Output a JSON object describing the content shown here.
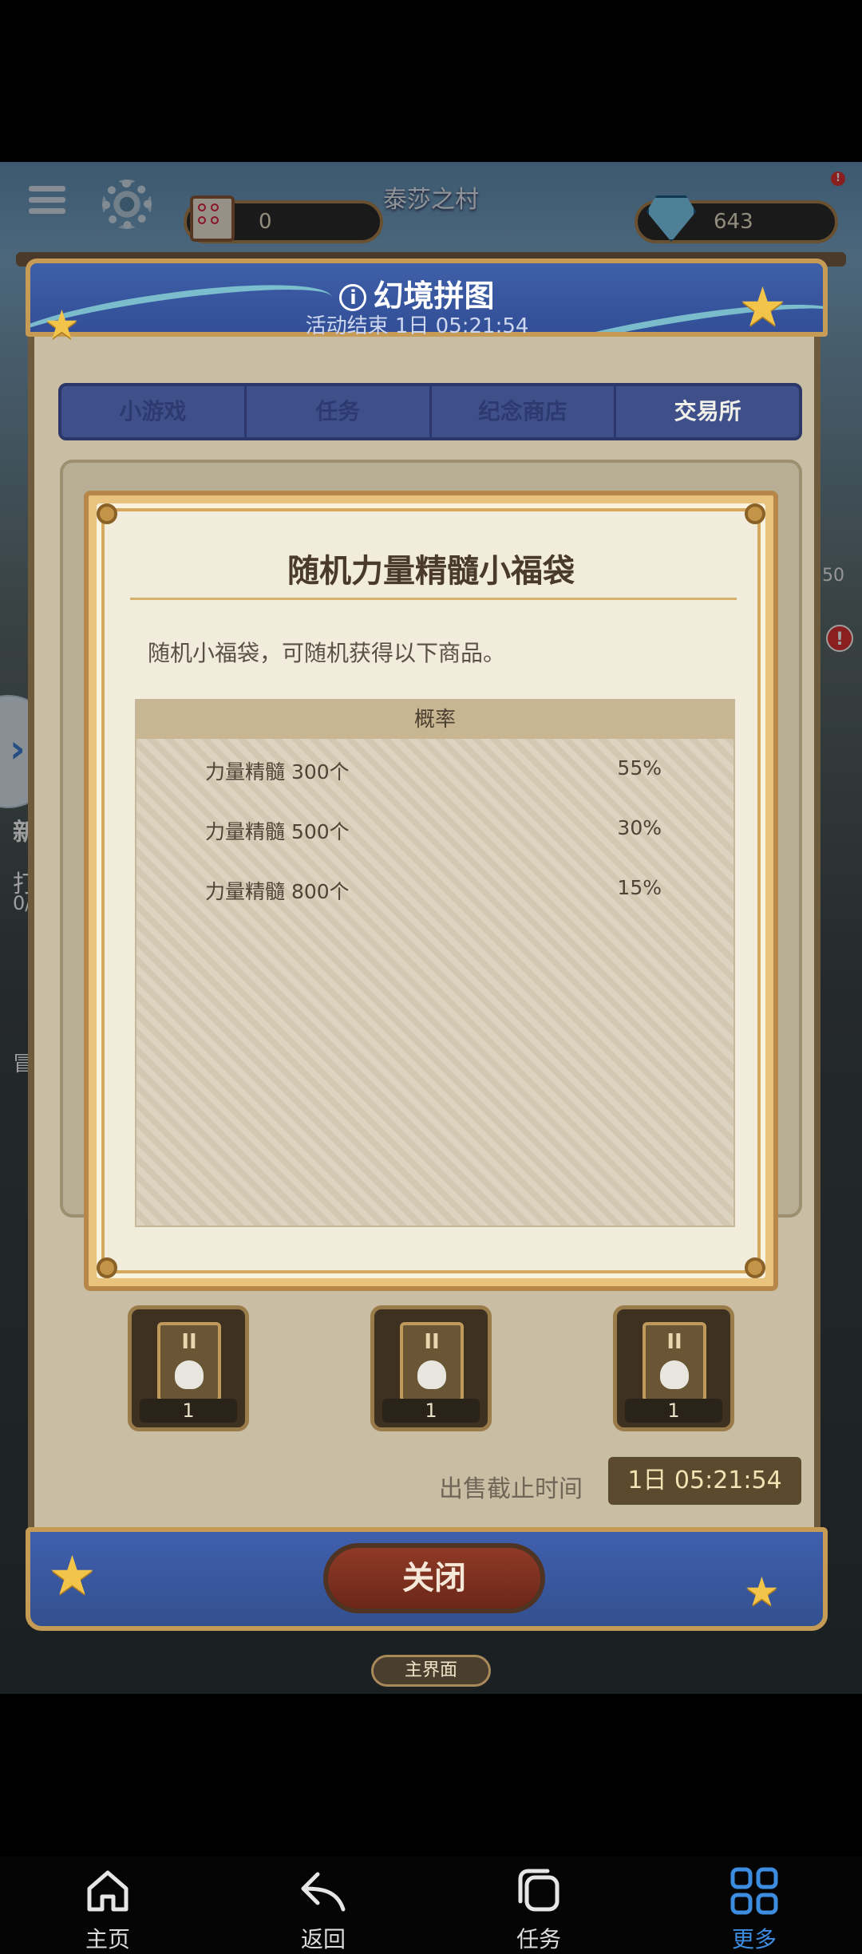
{
  "hud": {
    "village": "泰莎之村",
    "puzzle_count": "0",
    "gems": "643",
    "alert": "!"
  },
  "side": {
    "left_label_1": "新",
    "left_label_2": "打",
    "left_label_3": "0/",
    "left_label_4": "冒",
    "right_count": "50",
    "right_alert": "!"
  },
  "panel": {
    "title": "幻境拼图",
    "subtitle": "活动结束 1日 05:21:54",
    "tabs": [
      "小游戏",
      "任务",
      "纪念商店",
      "交易所"
    ],
    "active_tab": 3,
    "reward_cards": [
      {
        "tier": "II",
        "count": "1"
      },
      {
        "tier": "II",
        "count": "1"
      },
      {
        "tier": "II",
        "count": "1"
      }
    ],
    "sale_label": "出售截止时间",
    "sale_timer": "1日 05:21:54",
    "close_label": "关闭",
    "home_label": "主界面"
  },
  "popup": {
    "title": "随机力量精髓小福袋",
    "description": "随机小福袋，可随机获得以下商品。",
    "table_header": "概率",
    "rows": [
      {
        "name": "力量精髓 300个",
        "pct": "55%"
      },
      {
        "name": "力量精髓 500个",
        "pct": "30%"
      },
      {
        "name": "力量精髓 800个",
        "pct": "15%"
      }
    ]
  },
  "bottom_nav": {
    "items": [
      {
        "label": "主页",
        "icon": "home-icon"
      },
      {
        "label": "返回",
        "icon": "back-icon"
      },
      {
        "label": "任务",
        "icon": "tasks-icon"
      },
      {
        "label": "更多",
        "icon": "more-grid-icon"
      }
    ],
    "active_index": 3,
    "accent": "#3c8ce0"
  }
}
